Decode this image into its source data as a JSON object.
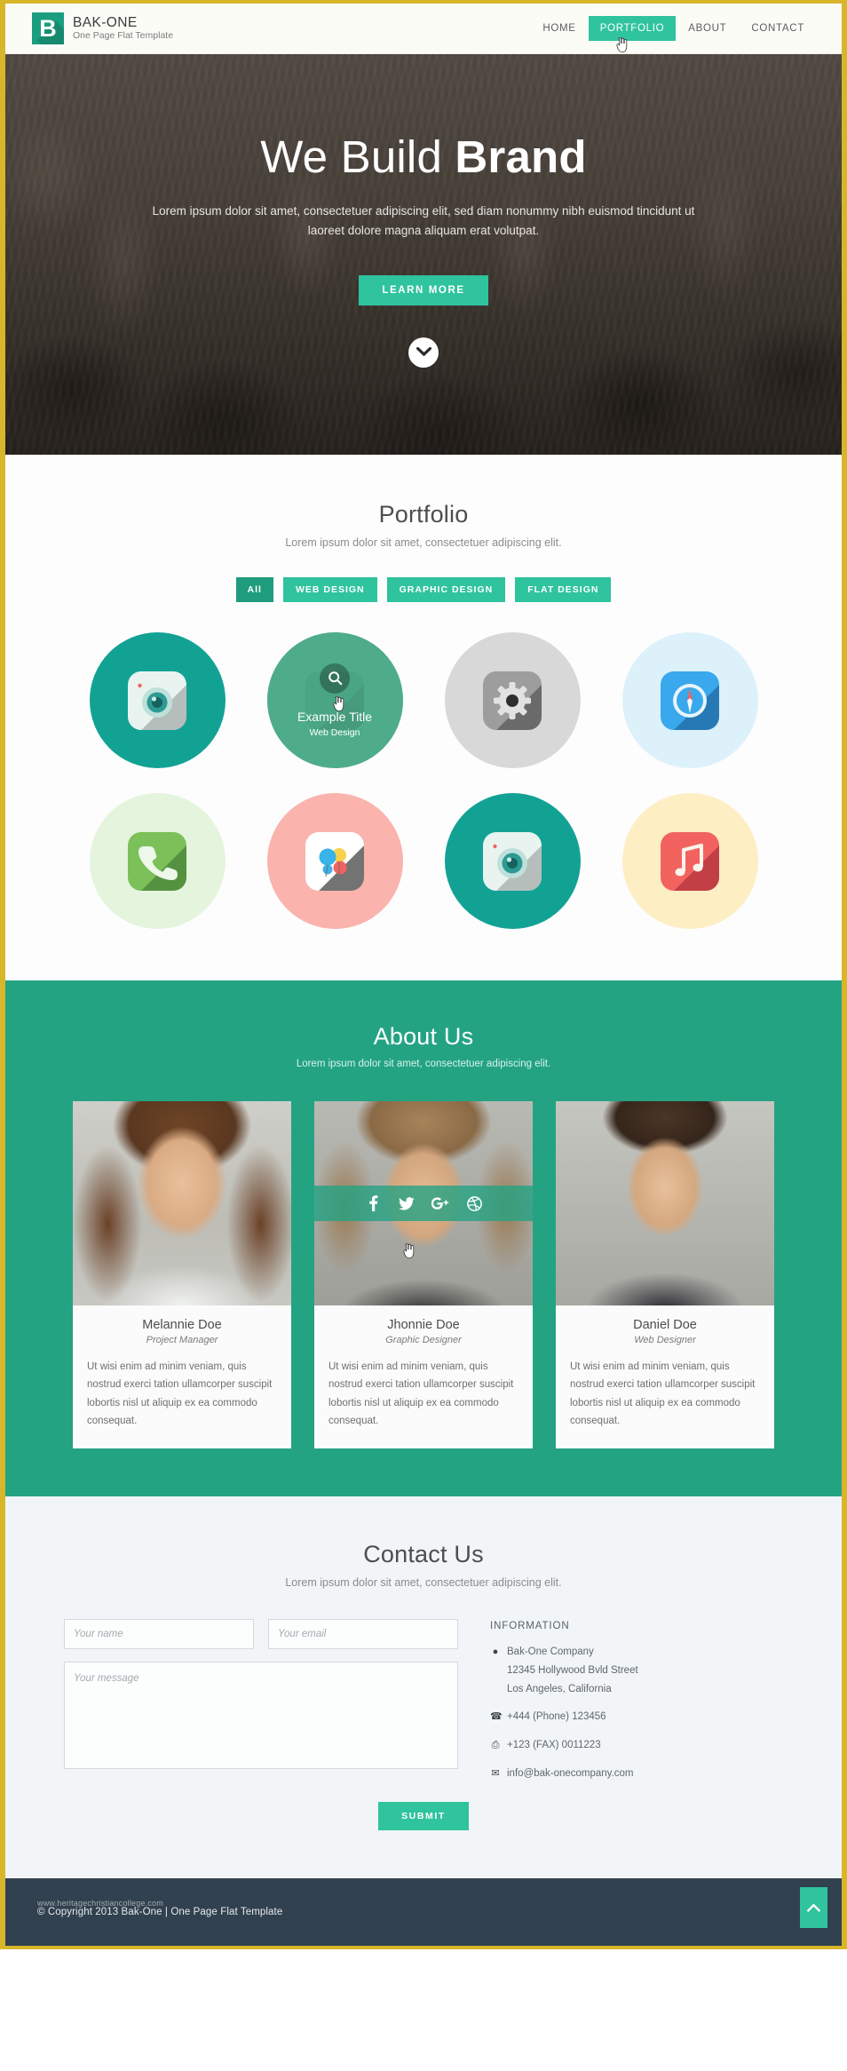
{
  "header": {
    "logo_letter": "B",
    "brand_title": "BAK-ONE",
    "brand_sub": "One Page Flat Template",
    "nav": [
      {
        "label": "HOME",
        "active": false
      },
      {
        "label": "PORTFOLIO",
        "active": true
      },
      {
        "label": "ABOUT",
        "active": false
      },
      {
        "label": "CONTACT",
        "active": false
      }
    ]
  },
  "hero": {
    "title_light": "We Build ",
    "title_bold": "Brand",
    "subtitle": "Lorem ipsum dolor sit amet, consectetuer adipiscing elit, sed diam nonummy nibh euismod tincidunt ut laoreet dolore magna aliquam erat volutpat.",
    "button_label": "LEARN MORE",
    "scroll_icon": "chevron-down-icon"
  },
  "portfolio": {
    "title": "Portfolio",
    "subtitle": "Lorem ipsum dolor sit amet, consectetuer adipiscing elit.",
    "filters": [
      {
        "label": "All",
        "active": true
      },
      {
        "label": "WEB DESIGN",
        "active": false
      },
      {
        "label": "GRAPHIC DESIGN",
        "active": false
      },
      {
        "label": "FLAT DESIGN",
        "active": false
      }
    ],
    "hover_overlay": {
      "title": "Example Title",
      "category": "Web Design",
      "icon": "search-icon"
    },
    "items": [
      {
        "icon": "camera-icon",
        "circle": "#12a294",
        "tile": "#eef6f4",
        "hovered": false
      },
      {
        "icon": "search-icon",
        "circle": "#5cb894",
        "tile": "#4a9d7f",
        "hovered": true
      },
      {
        "icon": "gear-icon",
        "circle": "#d8d8d8",
        "tile": "#9a9a9a",
        "hovered": false
      },
      {
        "icon": "compass-icon",
        "circle": "#ddf1fb",
        "tile": "#35a6ec",
        "hovered": false
      },
      {
        "icon": "phone-icon",
        "circle": "#e4f4dd",
        "tile": "#7cc05a",
        "hovered": false
      },
      {
        "icon": "balloons-icon",
        "circle": "#fbb3ae",
        "tile": "#ffffff",
        "hovered": false
      },
      {
        "icon": "camera-icon",
        "circle": "#12a294",
        "tile": "#eef6f4",
        "hovered": false
      },
      {
        "icon": "music-icon",
        "circle": "#fdeec4",
        "tile": "#f2635f",
        "hovered": false
      }
    ]
  },
  "about": {
    "title": "About Us",
    "subtitle": "Lorem ipsum dolor sit amet, consectetuer adipiscing elit.",
    "team": [
      {
        "name": "Melannie Doe",
        "role": "Project Manager",
        "desc": "Ut wisi enim ad minim veniam, quis nostrud exerci tation ullamcorper suscipit lobortis nisl ut aliquip ex ea commodo consequat.",
        "photo_hover": false
      },
      {
        "name": "Jhonnie Doe",
        "role": "Graphic Designer",
        "desc": "Ut wisi enim ad minim veniam, quis nostrud exerci tation ullamcorper suscipit lobortis nisl ut aliquip ex ea commodo consequat.",
        "photo_hover": true
      },
      {
        "name": "Daniel Doe",
        "role": "Web Designer",
        "desc": "Ut wisi enim ad minim veniam, quis nostrud exerci tation ullamcorper suscipit lobortis nisl ut aliquip ex ea commodo consequat.",
        "photo_hover": false
      }
    ],
    "social": [
      {
        "name": "facebook-icon",
        "glyph": "f"
      },
      {
        "name": "twitter-icon",
        "glyph": "t"
      },
      {
        "name": "google-plus-icon",
        "glyph": "g+"
      },
      {
        "name": "dribbble-icon",
        "glyph": "d"
      }
    ]
  },
  "contact": {
    "title": "Contact Us",
    "subtitle": "Lorem ipsum dolor sit amet, consectetuer adipiscing elit.",
    "name_placeholder": "Your name",
    "email_placeholder": "Your email",
    "message_placeholder": "Your message",
    "submit_label": "SUBMIT",
    "info_title": "INFORMATION",
    "company": "Bak-One Company",
    "address_line1": "12345 Hollywood Bvld Street",
    "address_line2": "Los Angeles, California",
    "phone": "+444 (Phone) 123456",
    "fax": "+123 (FAX) 0011223",
    "email": "info@bak-onecompany.com"
  },
  "footer": {
    "copyright": "© Copyright 2013 Bak-One | One Page Flat Template",
    "watermark": "www.heritagechristiancollege.com",
    "to_top_icon": "chevron-up-icon"
  },
  "colors": {
    "accent": "#2fc39e",
    "accent_dark": "#1f9c7d",
    "about_bg": "#24a383",
    "footer_bg": "#31414f",
    "page_border": "#d8b62a"
  }
}
